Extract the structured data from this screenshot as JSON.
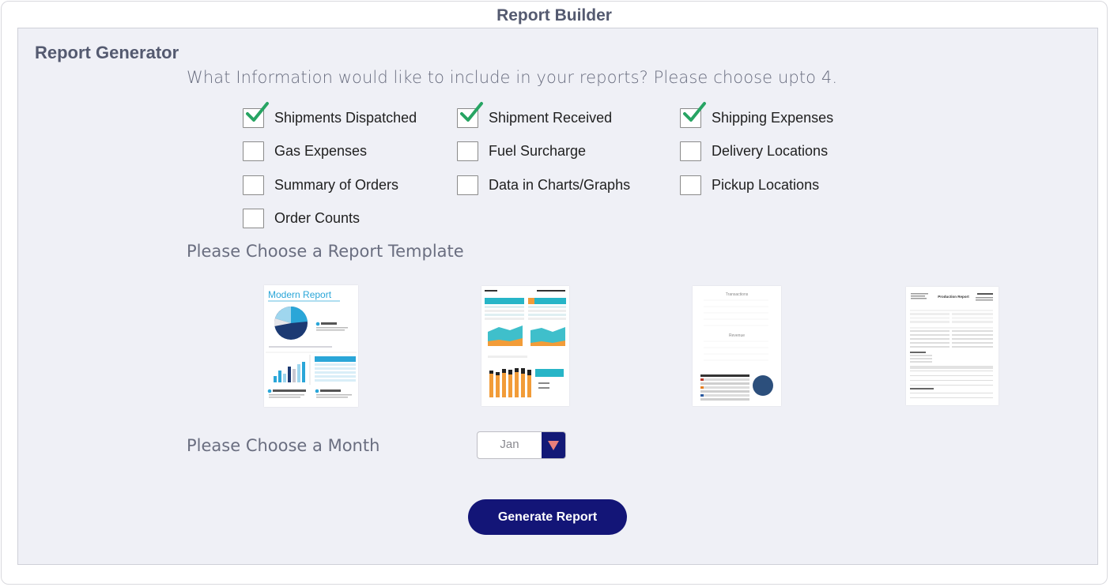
{
  "window": {
    "title": "Report Builder"
  },
  "generator": {
    "title": "Report Generator",
    "question": "What Information would like to include in your reports? Please choose upto 4.",
    "options": [
      {
        "label": "Shipments Dispatched",
        "checked": true
      },
      {
        "label": "Shipment Received",
        "checked": true
      },
      {
        "label": "Shipping Expenses",
        "checked": true
      },
      {
        "label": "Gas Expenses",
        "checked": false
      },
      {
        "label": "Fuel Surcharge",
        "checked": false
      },
      {
        "label": "Delivery Locations",
        "checked": false
      },
      {
        "label": "Summary of Orders",
        "checked": false
      },
      {
        "label": "Data in Charts/Graphs",
        "checked": false
      },
      {
        "label": "Pickup Locations",
        "checked": false
      },
      {
        "label": "Order Counts",
        "checked": false
      }
    ],
    "check_color": "#27a463"
  },
  "templates": {
    "heading": "Please Choose a Report Template",
    "items": [
      {
        "name": "modern-report",
        "title": "Modern Report"
      },
      {
        "name": "dashboard-report"
      },
      {
        "name": "transactions-report",
        "title": "Transactions",
        "subtitle": "Revenue"
      },
      {
        "name": "production-report",
        "title": "Production Report"
      }
    ]
  },
  "month": {
    "label": "Please Choose a Month",
    "value": "Jan",
    "arrow_icon": "triangle-down-icon",
    "arrow_color": "#e97f7b"
  },
  "actions": {
    "generate_label": "Generate Report",
    "button_color": "#131577"
  }
}
